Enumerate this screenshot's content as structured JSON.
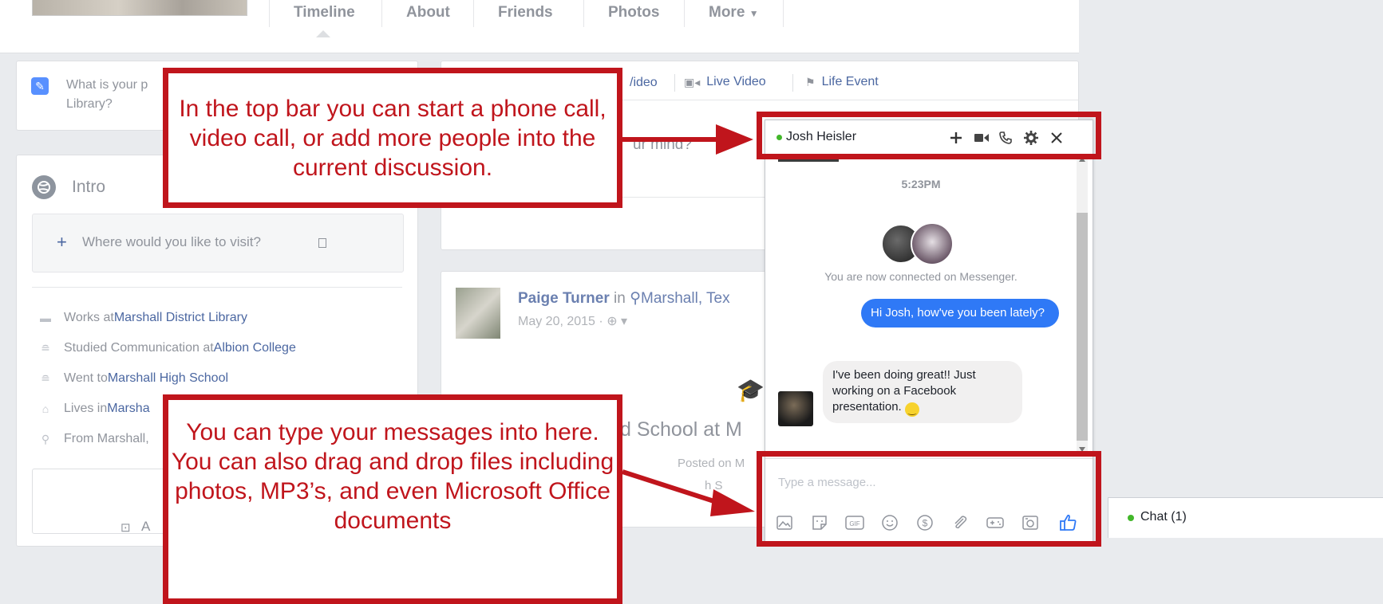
{
  "nav": {
    "tabs": [
      "Timeline",
      "About",
      "Friends",
      "Photos",
      "More"
    ]
  },
  "composer": {
    "prompt_partial": "What is your p",
    "prompt_line2": "Library?",
    "option_video": "/ideo",
    "option_live": "Live Video",
    "option_life": "Life Event",
    "placeholder_partial": "ur mind?"
  },
  "intro": {
    "title": "Intro",
    "add_prompt": "Where would you like to visit?",
    "items": [
      {
        "icon": "briefcase-icon",
        "pre": "Works at ",
        "link": "Marshall District Library"
      },
      {
        "icon": "graduation-cap-icon",
        "pre": "Studied Communication at ",
        "link": "Albion College"
      },
      {
        "icon": "graduation-cap-icon",
        "pre": "Went to ",
        "link": "Marshall High School"
      },
      {
        "icon": "house-icon",
        "pre": "Lives in ",
        "link": "Marsha"
      },
      {
        "icon": "location-pin-icon",
        "pre": "From Marshall,",
        "link": ""
      }
    ],
    "add_partial": "A"
  },
  "post": {
    "author": "Paige Turner",
    "in_word": "in",
    "location": "Marshall, Tex",
    "date": "May 20, 2015 ·",
    "headline_partial": "d School at M",
    "posted_partial": "Posted on M",
    "sub_partial": "h S"
  },
  "chat": {
    "contact": "Josh Heisler",
    "time": "5:23PM",
    "connected_text": "You are now connected on Messenger.",
    "sent_message": "Hi Josh, how've you been lately?",
    "received_message": "I've been doing great!! Just working on a Facebook presentation.",
    "input_placeholder": "Type a message...",
    "header_icons": [
      "plus-icon",
      "video-camera-icon",
      "phone-icon",
      "gear-icon",
      "close-icon"
    ],
    "composer_icons": [
      "photo-icon",
      "sticker-icon",
      "gif-icon",
      "emoji-icon",
      "payment-icon",
      "attachment-icon",
      "game-icon",
      "camera-icon",
      "like-icon"
    ]
  },
  "chat_tab": {
    "label": "Chat (1)"
  },
  "annotations": {
    "top": "In the top bar you can start a phone call, video call, or add more people into the current discussion.",
    "bottom": "You can type your messages into here. You can also drag and drop files including photos, MP3’s, and even Microsoft Office documents"
  },
  "colors": {
    "annotation_red": "#c0151c",
    "messenger_blue": "#2f79f6",
    "online_green": "#42b72a",
    "link_blue": "#4b67a1"
  }
}
